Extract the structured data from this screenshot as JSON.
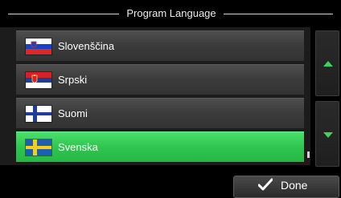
{
  "header": {
    "title": "Program Language"
  },
  "languages": [
    {
      "label": "Slovenščina",
      "flag_icon": "slovenia-flag-icon",
      "selected": false
    },
    {
      "label": "Srpski",
      "flag_icon": "serbia-flag-icon",
      "selected": false
    },
    {
      "label": "Suomi",
      "flag_icon": "finland-flag-icon",
      "selected": false
    },
    {
      "label": "Svenska",
      "flag_icon": "sweden-flag-icon",
      "selected": true
    }
  ],
  "scroll": {
    "up_icon": "arrow-up-icon",
    "down_icon": "arrow-down-icon"
  },
  "footer": {
    "done_label": "Done",
    "done_icon": "checkmark-icon"
  },
  "colors": {
    "accent": "#3dd35b",
    "selected_row": "#2fc54f",
    "row": "#444444",
    "background": "#000000"
  }
}
